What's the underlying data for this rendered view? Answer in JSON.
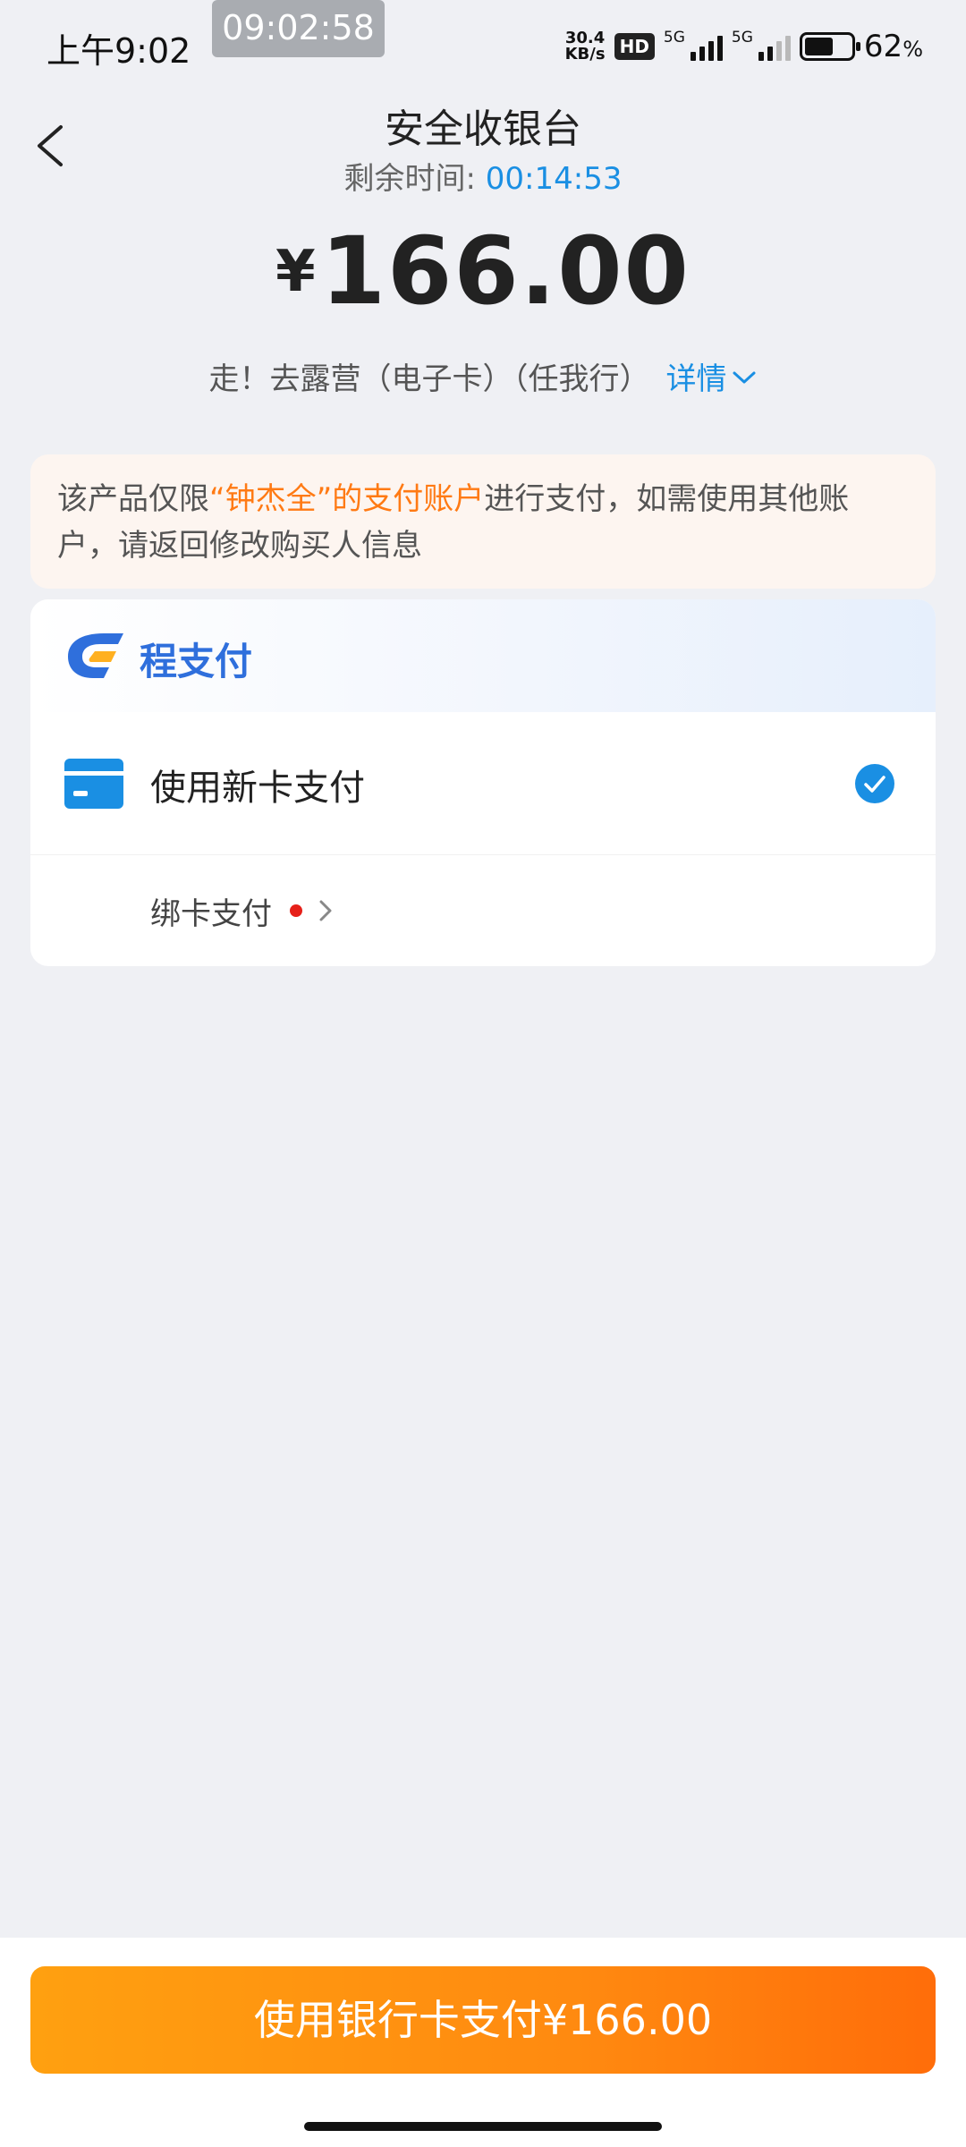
{
  "status_bar": {
    "time": "上午9:02",
    "clock_overlay": "09:02:58",
    "net_speed_value": "30.4",
    "net_speed_unit": "KB/s",
    "hd_badge": "HD",
    "signal_1_tag": "5G",
    "signal_2_tag": "5G",
    "battery_percent": "62",
    "battery_unit": "%",
    "battery_level": 0.62
  },
  "header": {
    "title": "安全收银台",
    "countdown_label": "剩余时间: ",
    "countdown_value": "00:14:53",
    "back_icon": "chevron-left-icon"
  },
  "order": {
    "currency_symbol": "¥",
    "amount": "166.00",
    "product_name": "走！去露营（电子卡）（任我行）",
    "detail_link": "详情",
    "detail_icon": "chevron-down-icon"
  },
  "notice": {
    "prefix": "该产品仅限",
    "highlight": "“钟杰全”的支付账户",
    "suffix": "进行支付，如需使用其他账户，请返回修改购买人信息"
  },
  "payment": {
    "brand_name": "程支付",
    "brand_icon": "cheng-pay-logo-icon",
    "options": [
      {
        "label": "使用新卡支付",
        "icon": "credit-card-icon",
        "selected": true
      }
    ],
    "bind_card_label": "绑卡支付"
  },
  "footer": {
    "pay_button_label": "使用银行卡支付¥166.00"
  },
  "colors": {
    "accent_blue": "#1a8fe3",
    "highlight_orange": "#ff7a14",
    "button_gradient_start": "#ffa010",
    "button_gradient_end": "#ff6d0a",
    "background": "#eff0f4"
  }
}
